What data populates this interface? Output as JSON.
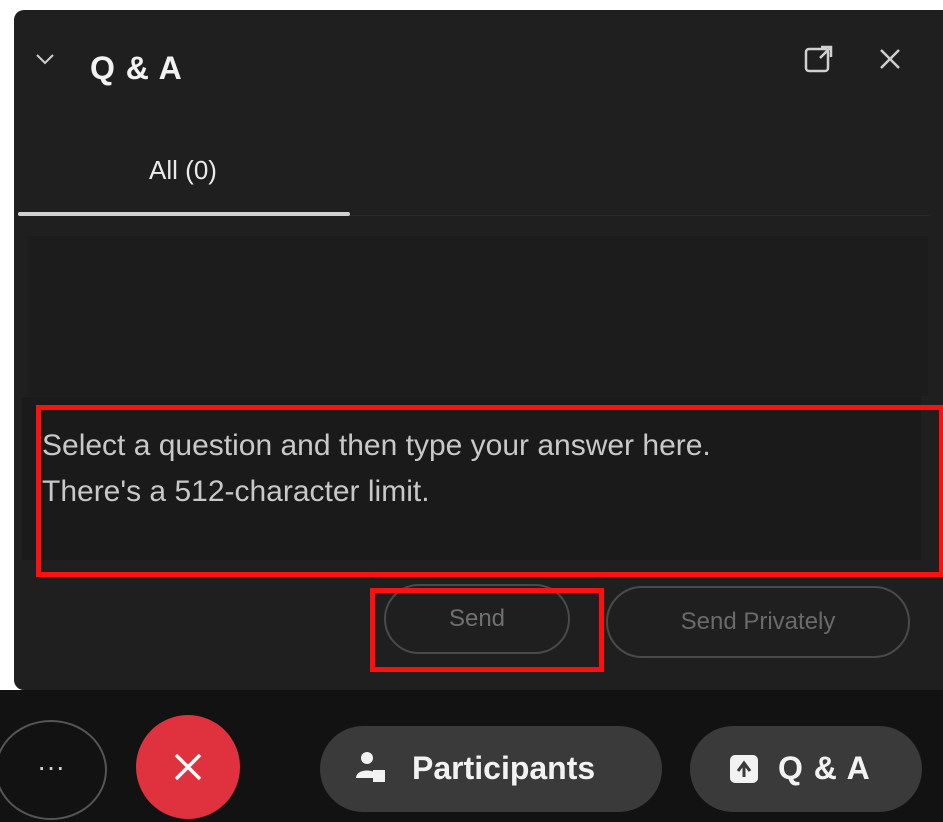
{
  "header": {
    "title": "Q & A",
    "collapse_icon": "chevron-down-icon",
    "popout_icon": "popout-icon",
    "close_icon": "close-icon"
  },
  "tabs": [
    {
      "label": "All (0)",
      "selected": true
    }
  ],
  "answer": {
    "placeholder": "Select a question and then type your answer here.\nThere's a 512-character limit.",
    "value": ""
  },
  "actions": {
    "send_label": "Send",
    "send_privately_label": "Send Privately"
  },
  "bottom_bar": {
    "more_label": "···",
    "leave_icon": "close-icon",
    "participants_label": "Participants",
    "participants_icon": "participants-icon",
    "qa_label": "Q & A",
    "qa_icon": "qa-icon"
  },
  "highlight_color": "#ff1010",
  "leave_color": "#e0323e"
}
